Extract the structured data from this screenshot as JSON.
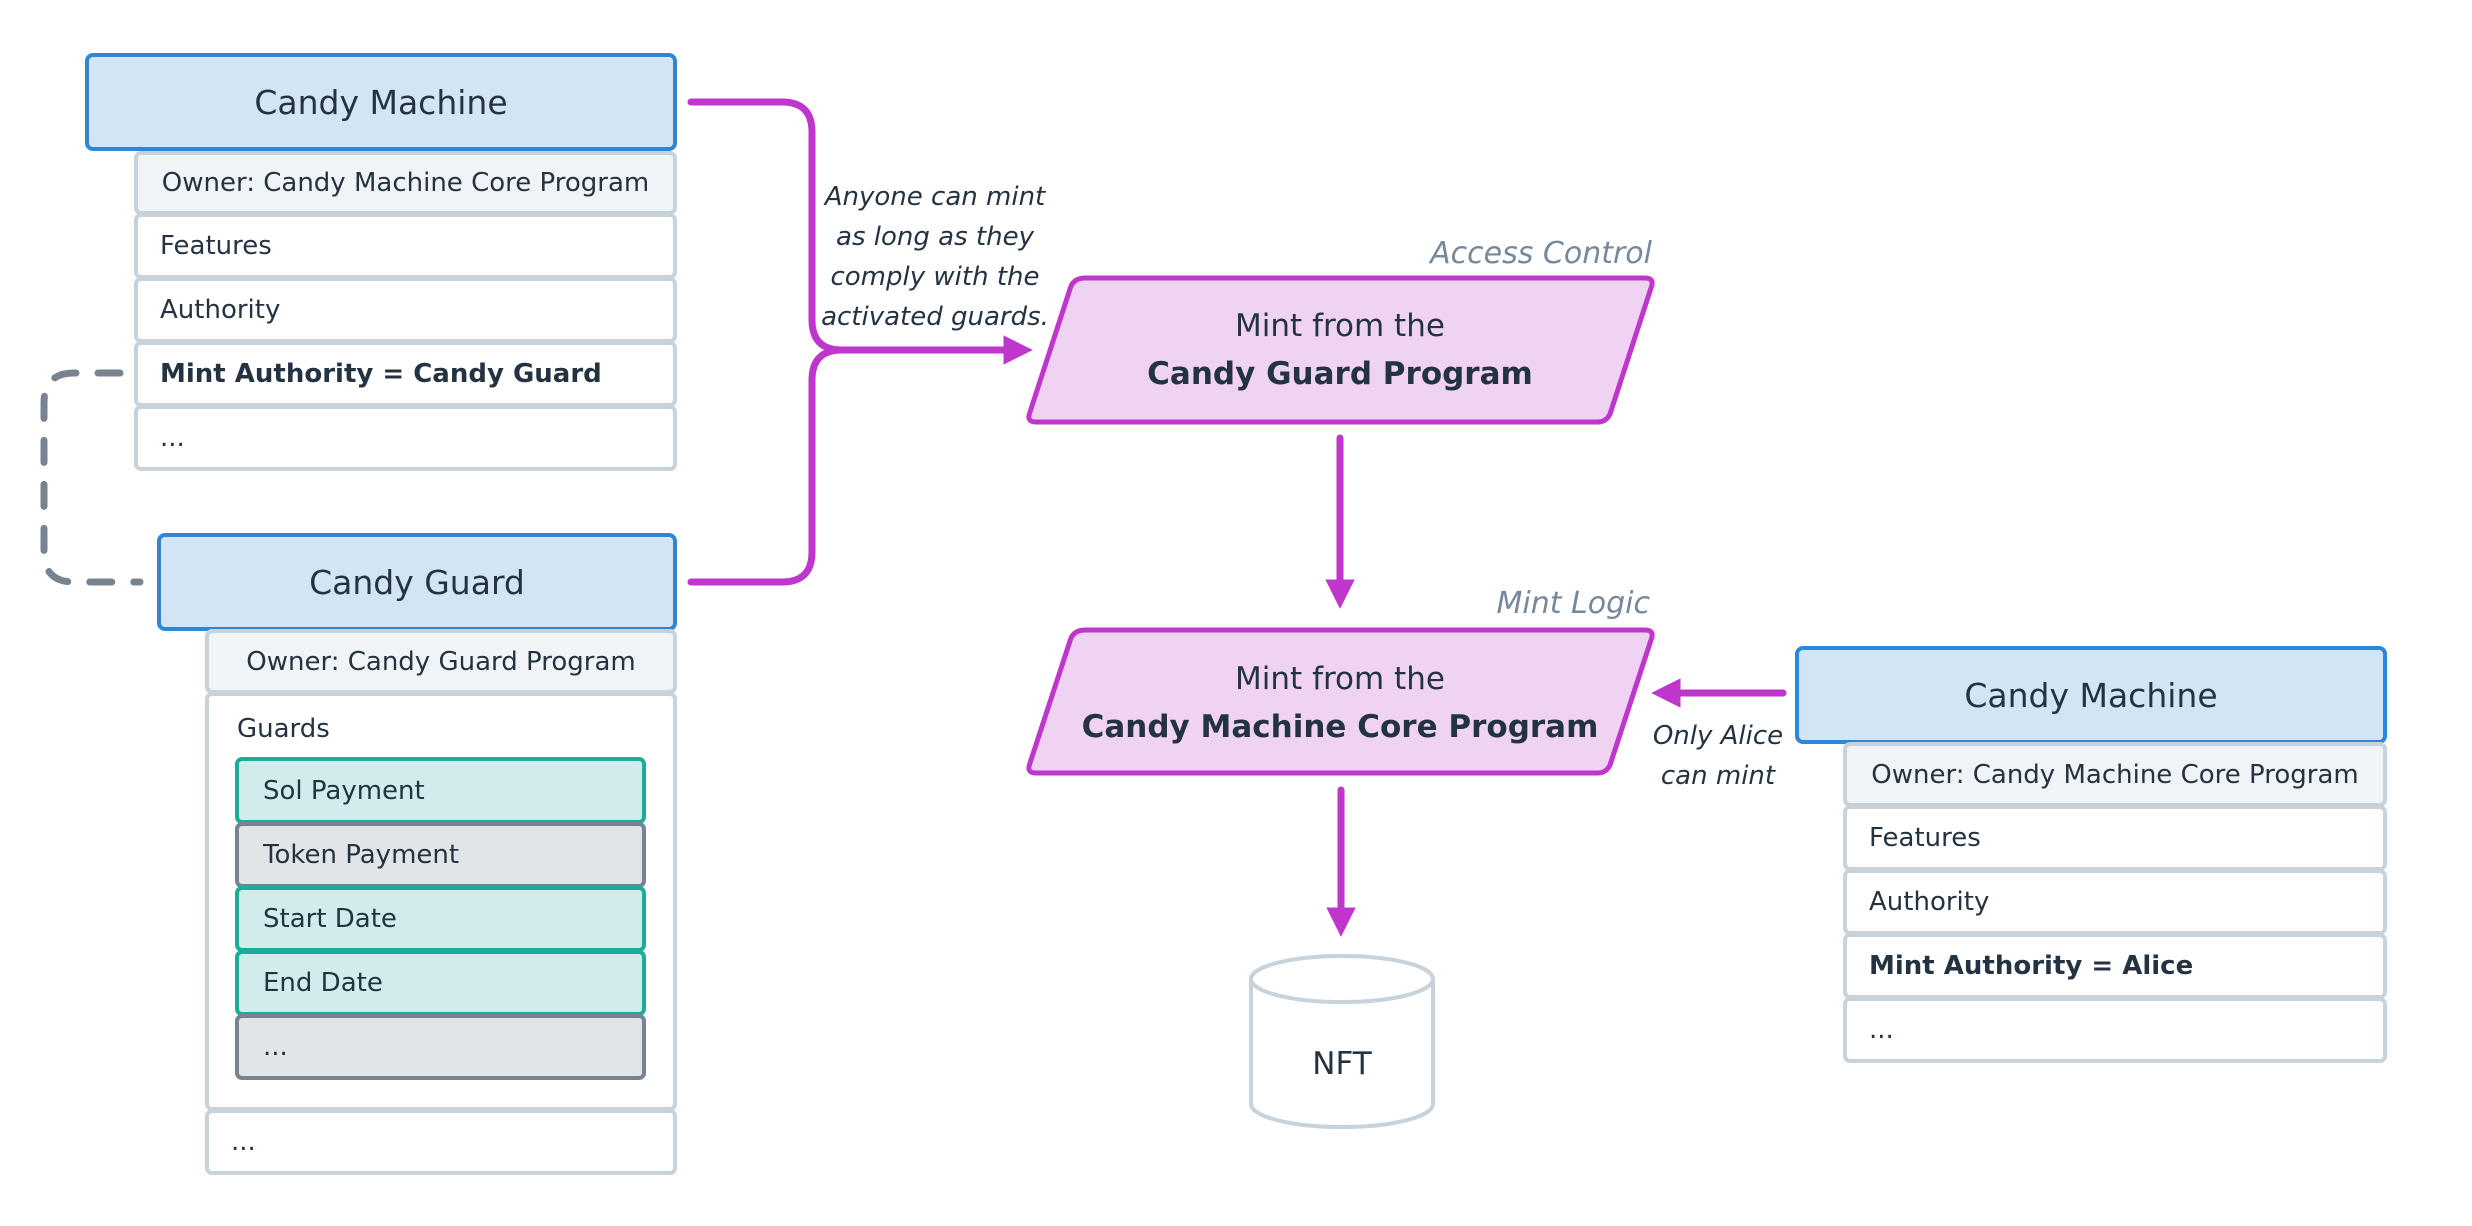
{
  "colors": {
    "accent_purple": "#bf36cd",
    "header_blue": "#2d87d6",
    "active_guard_teal": "#1bad9b",
    "inactive_guard_gray": "#77848f"
  },
  "left_candy_machine": {
    "title": "Candy Machine",
    "owner": "Owner: Candy Machine Core Program",
    "rows": [
      "Features",
      "Authority",
      "Mint Authority = Candy Guard",
      "..."
    ]
  },
  "candy_guard": {
    "title": "Candy Guard",
    "owner": "Owner: Candy Guard Program",
    "guards_label": "Guards",
    "guards": [
      {
        "label": "Sol Payment",
        "active": true
      },
      {
        "label": "Token Payment",
        "active": false
      },
      {
        "label": "Start Date",
        "active": true
      },
      {
        "label": "End Date",
        "active": true
      },
      {
        "label": "...",
        "active": false
      }
    ],
    "footer": "..."
  },
  "annotation_anyone": [
    "Anyone can mint",
    "as long as they",
    "comply with the",
    "activated guards."
  ],
  "access_control": {
    "tag": "Access Control",
    "line1": "Mint from the",
    "line2": "Candy Guard Program"
  },
  "mint_logic": {
    "tag": "Mint Logic",
    "line1": "Mint from the",
    "line2": "Candy Machine Core Program"
  },
  "annotation_alice": [
    "Only Alice",
    "can mint"
  ],
  "nft": {
    "label": "NFT"
  },
  "right_candy_machine": {
    "title": "Candy Machine",
    "owner": "Owner: Candy Machine Core Program",
    "rows": [
      "Features",
      "Authority",
      "Mint Authority = Alice",
      "..."
    ]
  }
}
